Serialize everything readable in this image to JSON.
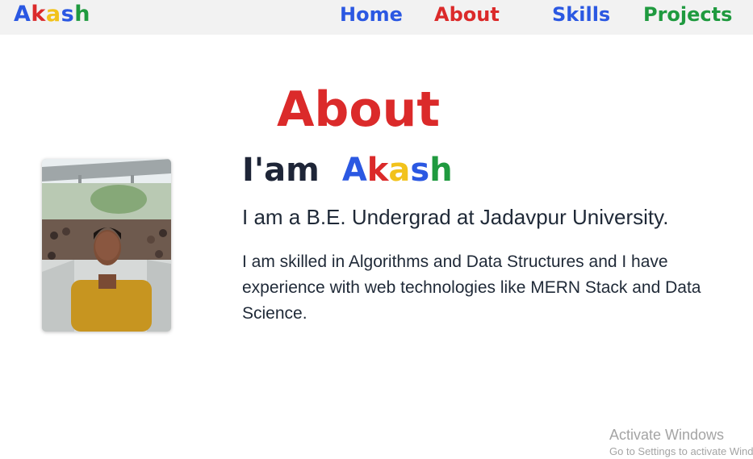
{
  "logo": {
    "letters": [
      "A",
      "k",
      "a",
      "s",
      "h"
    ],
    "colors": [
      "#2b58e2",
      "#db2a2a",
      "#f2c21b",
      "#2b58e2",
      "#1f9a3f"
    ]
  },
  "nav": {
    "home": "Home",
    "about": "About",
    "skills": "Skills",
    "projects": "Projects"
  },
  "about": {
    "title": "About",
    "intro_prefix": "I'am",
    "name_letters": [
      "A",
      "k",
      "a",
      "s",
      "h"
    ],
    "subtitle": "I am a B.E. Undergrad at Jadavpur University.",
    "description": "I am skilled in Algorithms and Data Structures and I have experience with web technologies like MERN Stack and Data Science."
  },
  "watermark": {
    "line1": "Activate Windows",
    "line2": "Go to Settings to activate Windows."
  }
}
